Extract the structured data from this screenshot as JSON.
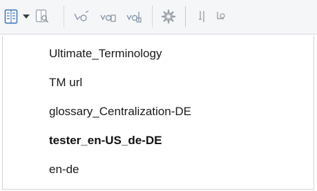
{
  "toolbar": {
    "buttons": [
      {
        "icon": "termbase-list-icon"
      },
      {
        "icon": "dropdown-arrow-icon"
      },
      {
        "icon": "termbase-search-icon"
      },
      {
        "icon": "add-term-icon"
      },
      {
        "icon": "add-new-term-icon"
      },
      {
        "icon": "delete-term-icon"
      },
      {
        "icon": "settings-gear-icon"
      },
      {
        "icon": "term-filter-icon"
      },
      {
        "icon": "term-options-icon"
      }
    ],
    "colors": {
      "background": "#f5f6f7",
      "icon_blue": "#2f6fb5",
      "icon_green": "#5aa63a",
      "icon_gray": "#7b7f85"
    }
  },
  "menu": {
    "items": [
      {
        "label": "Ultimate_Terminology",
        "selected": false
      },
      {
        "label": "TM url",
        "selected": false
      },
      {
        "label": "glossary_Centralization-DE",
        "selected": false
      },
      {
        "label": "tester_en-US_de-DE",
        "selected": true
      },
      {
        "label": "en-de",
        "selected": false
      }
    ]
  }
}
